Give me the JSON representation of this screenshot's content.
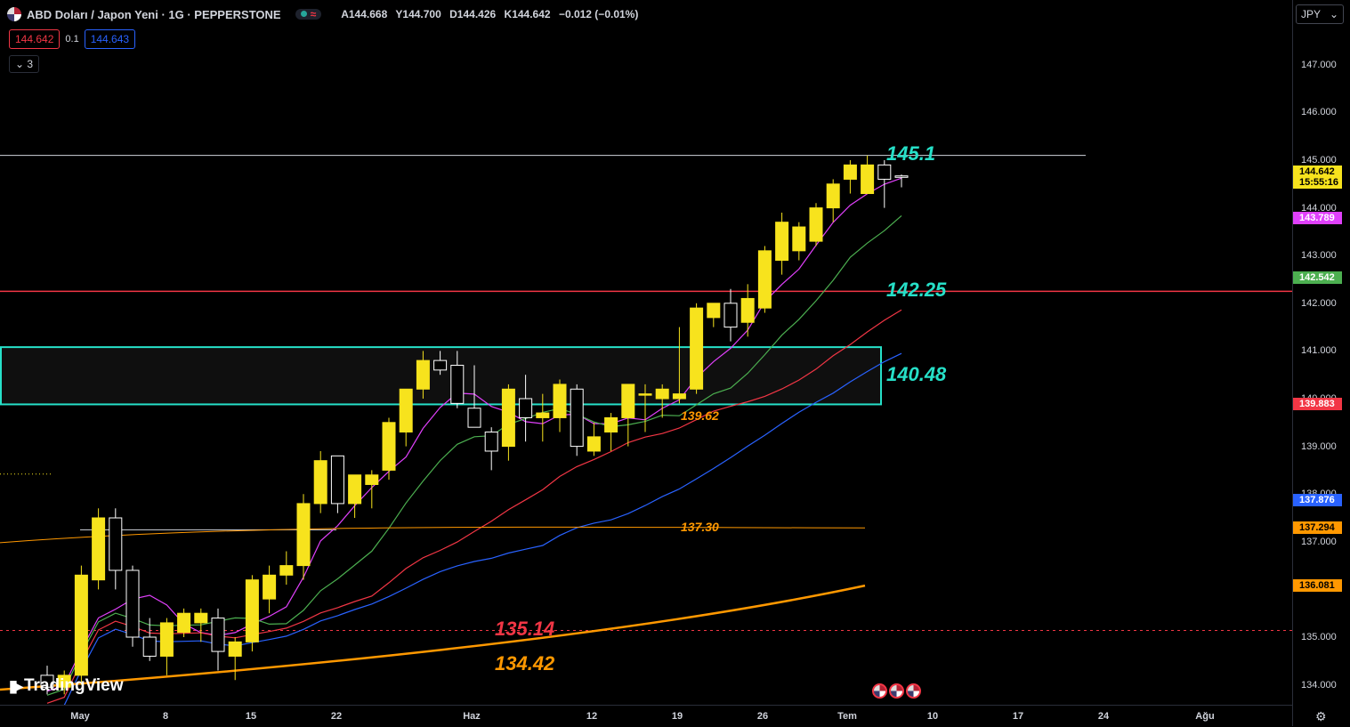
{
  "header": {
    "symbol_title": "ABD Doları / Japon Yeni · 1G · PEPPERSTONE",
    "ohlc": [
      {
        "k": "A",
        "v": "144.668"
      },
      {
        "k": "Y",
        "v": "144.700"
      },
      {
        "k": "D",
        "v": "144.426"
      },
      {
        "k": "K",
        "v": "144.642"
      }
    ],
    "change": "−0.012 (−0.01%)",
    "sell_price": "144.642",
    "spread": "0.1",
    "buy_price": "144.643",
    "indicators_collapse_label": "⌄ 3"
  },
  "currency_selector": {
    "label": "JPY",
    "arrow": "⌄"
  },
  "price_axis": {
    "labels": [
      "147.000",
      "146.000",
      "145.000",
      "144.000",
      "143.000",
      "142.000",
      "141.000",
      "140.000",
      "139.000",
      "138.000",
      "137.000",
      "135.000",
      "134.000"
    ],
    "tags": [
      {
        "text": "144.642\n15:55:16",
        "color": "#f7e31d",
        "dark": true,
        "price": 144.64
      },
      {
        "text": "143.789",
        "color": "#e040fb",
        "dark": false,
        "price": 143.79
      },
      {
        "text": "142.542",
        "color": "#4caf50",
        "dark": false,
        "price": 142.54
      },
      {
        "text": "139.883",
        "color": "#f23645",
        "dark": false,
        "price": 139.88
      },
      {
        "text": "137.876",
        "color": "#2962ff",
        "dark": false,
        "price": 137.88
      },
      {
        "text": "137.294",
        "color": "#ff9800",
        "dark": true,
        "price": 137.29
      },
      {
        "text": "136.081",
        "color": "#ff9800",
        "dark": true,
        "price": 136.08
      }
    ]
  },
  "time_axis": {
    "labels": [
      "May",
      "8",
      "15",
      "22",
      "Haz",
      "12",
      "19",
      "26",
      "Tem",
      "10",
      "17",
      "24",
      "Ağu"
    ]
  },
  "annotations": [
    {
      "text": "145.1",
      "color": "#26e0c8",
      "price": 145.1
    },
    {
      "text": "142.25",
      "color": "#26e0c8",
      "price": 142.25
    },
    {
      "text": "140.48",
      "color": "#26e0c8",
      "price": 140.48
    },
    {
      "text": "139.62",
      "color": "#ff9800",
      "price": 139.62
    },
    {
      "text": "137.30",
      "color": "#ff9800",
      "price": 137.3
    },
    {
      "text": "135.14",
      "color": "#f23645",
      "price": 135.14
    },
    {
      "text": "134.42",
      "color": "#ff9800",
      "price": 134.42
    }
  ],
  "branding": {
    "logo_text": "TradingView"
  },
  "colors": {
    "candle": "#f7e31d",
    "zone": "#26e0c8",
    "resistance_red": "#f23645",
    "resistance_white": "#d1d4dc"
  },
  "chart_data": {
    "type": "candlestick",
    "symbol": "ABD Doları / Japon Yeni",
    "timeframe": "1G",
    "ylim": [
      133.6,
      147.6
    ],
    "candles": [
      [
        134.2,
        134.4,
        133.8,
        133.95
      ],
      [
        133.95,
        134.3,
        133.8,
        134.2
      ],
      [
        134.2,
        136.5,
        134.0,
        136.3
      ],
      [
        136.2,
        137.7,
        136.0,
        137.5
      ],
      [
        137.5,
        137.7,
        136.0,
        136.4
      ],
      [
        136.4,
        136.5,
        134.8,
        135.0
      ],
      [
        135.0,
        135.4,
        134.5,
        134.6
      ],
      [
        134.6,
        135.4,
        134.2,
        135.3
      ],
      [
        135.1,
        135.6,
        135.0,
        135.5
      ],
      [
        135.3,
        135.6,
        134.9,
        135.5
      ],
      [
        135.4,
        135.6,
        134.3,
        134.7
      ],
      [
        134.6,
        135.0,
        134.1,
        134.9
      ],
      [
        134.9,
        136.3,
        134.7,
        136.2
      ],
      [
        135.8,
        136.5,
        135.5,
        136.3
      ],
      [
        136.3,
        136.8,
        136.1,
        136.5
      ],
      [
        136.5,
        138.0,
        136.2,
        137.8
      ],
      [
        137.8,
        138.9,
        137.6,
        138.7
      ],
      [
        138.8,
        138.8,
        137.6,
        137.8
      ],
      [
        137.8,
        138.3,
        137.5,
        138.4
      ],
      [
        138.2,
        138.5,
        137.7,
        138.4
      ],
      [
        138.5,
        139.6,
        138.3,
        139.5
      ],
      [
        139.3,
        140.2,
        139.0,
        140.2
      ],
      [
        140.2,
        141.0,
        140.0,
        140.8
      ],
      [
        140.8,
        141.0,
        140.5,
        140.6
      ],
      [
        140.7,
        141.0,
        139.8,
        139.9
      ],
      [
        139.8,
        140.7,
        139.6,
        139.4
      ],
      [
        139.3,
        139.4,
        138.5,
        138.9
      ],
      [
        139.0,
        140.3,
        138.7,
        140.2
      ],
      [
        140.0,
        140.5,
        139.1,
        139.6
      ],
      [
        139.6,
        140.1,
        139.1,
        139.7
      ],
      [
        139.6,
        140.4,
        139.3,
        140.3
      ],
      [
        140.2,
        140.3,
        138.8,
        139.0
      ],
      [
        138.9,
        139.5,
        138.8,
        139.2
      ],
      [
        139.3,
        139.7,
        138.9,
        139.6
      ],
      [
        139.6,
        140.3,
        139.0,
        140.3
      ],
      [
        140.1,
        140.3,
        139.3,
        140.1
      ],
      [
        140.0,
        140.3,
        139.6,
        140.2
      ],
      [
        140.0,
        141.5,
        139.9,
        140.1
      ],
      [
        140.2,
        142.0,
        140.1,
        141.9
      ],
      [
        141.7,
        142.0,
        141.5,
        142.0
      ],
      [
        142.0,
        142.3,
        141.2,
        141.5
      ],
      [
        141.6,
        142.4,
        141.3,
        142.1
      ],
      [
        141.9,
        143.2,
        141.8,
        143.1
      ],
      [
        142.9,
        143.9,
        142.6,
        143.7
      ],
      [
        143.1,
        143.7,
        142.9,
        143.6
      ],
      [
        143.3,
        144.1,
        143.2,
        144.0
      ],
      [
        144.0,
        144.6,
        143.7,
        144.5
      ],
      [
        144.6,
        145.0,
        144.3,
        144.9
      ],
      [
        144.3,
        145.1,
        144.3,
        144.9
      ],
      [
        144.9,
        145.0,
        144.0,
        144.6
      ],
      [
        144.67,
        144.7,
        144.43,
        144.64
      ]
    ]
  }
}
